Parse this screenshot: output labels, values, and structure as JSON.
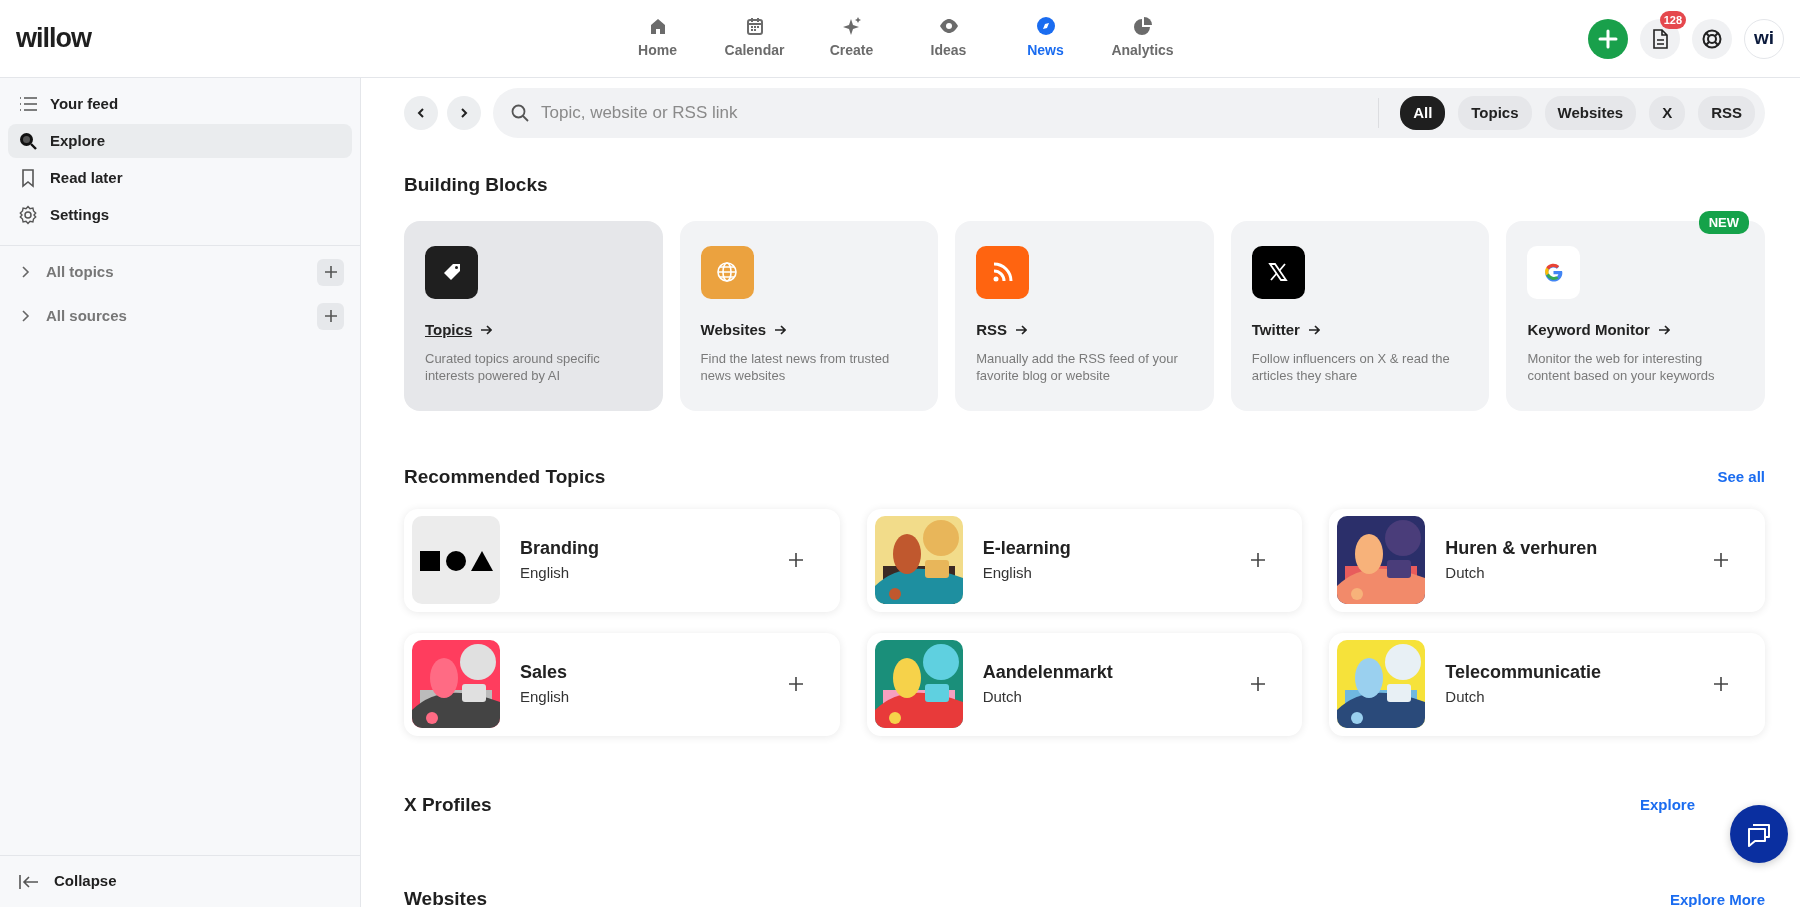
{
  "app": {
    "logo": "willow"
  },
  "nav": [
    {
      "kind": "home",
      "label": "Home",
      "selected": false
    },
    {
      "kind": "calendar",
      "label": "Calendar",
      "selected": false
    },
    {
      "kind": "sparkle",
      "label": "Create",
      "selected": false
    },
    {
      "kind": "eye",
      "label": "Ideas",
      "selected": false
    },
    {
      "kind": "compass",
      "label": "News",
      "selected": true
    },
    {
      "kind": "pie",
      "label": "Analytics",
      "selected": false
    }
  ],
  "header_actions": {
    "notification_count": "128",
    "avatar": "wi"
  },
  "sidebar": {
    "items": [
      {
        "kind": "list",
        "label": "Your feed",
        "selected": false
      },
      {
        "kind": "search",
        "label": "Explore",
        "selected": true
      },
      {
        "kind": "bookmark",
        "label": "Read later",
        "selected": false
      },
      {
        "kind": "gear",
        "label": "Settings",
        "selected": false
      }
    ],
    "groups": [
      {
        "label": "All topics",
        "expanded": false
      },
      {
        "label": "All sources",
        "expanded": false
      }
    ],
    "collapse": "Collapse"
  },
  "search": {
    "placeholder": "Topic, website or RSS link",
    "filters": [
      {
        "label": "All",
        "selected": true
      },
      {
        "label": "Topics",
        "selected": false
      },
      {
        "label": "Websites",
        "selected": false
      },
      {
        "label": "X",
        "selected": false
      },
      {
        "label": "RSS",
        "selected": false
      }
    ]
  },
  "building_blocks": {
    "title": "Building Blocks",
    "cards": [
      {
        "kind": "tag",
        "title": "Topics",
        "description": "Curated topics around specific interests powered by AI",
        "hovered": true
      },
      {
        "kind": "globe",
        "title": "Websites",
        "description": "Find the latest news from trusted news websites",
        "hovered": false
      },
      {
        "kind": "rss",
        "title": "RSS",
        "description": "Manually add the RSS feed of your favorite blog or website",
        "hovered": false
      },
      {
        "kind": "x",
        "title": "Twitter",
        "description": "Follow influencers on X & read the articles they share",
        "hovered": false
      },
      {
        "kind": "google",
        "title": "Keyword Monitor",
        "description": "Monitor the web for interesting content based on your keywords",
        "hovered": false,
        "badge": "NEW"
      }
    ]
  },
  "recommended": {
    "title": "Recommended Topics",
    "link": "See all",
    "topics": [
      {
        "kind": "shapes",
        "name": "Branding",
        "language": "English"
      },
      {
        "kind": "picture",
        "name": "E-learning",
        "language": "English"
      },
      {
        "kind": "picture",
        "name": "Huren & verhuren",
        "language": "Dutch"
      },
      {
        "kind": "picture",
        "name": "Sales",
        "language": "English"
      },
      {
        "kind": "picture",
        "name": "Aandelenmarkt",
        "language": "Dutch"
      },
      {
        "kind": "picture",
        "name": "Telecommunicatie",
        "language": "Dutch"
      }
    ]
  },
  "sections": [
    {
      "title": "X Profiles",
      "link": "Explore"
    },
    {
      "title": "Websites",
      "link": "Explore More"
    }
  ]
}
